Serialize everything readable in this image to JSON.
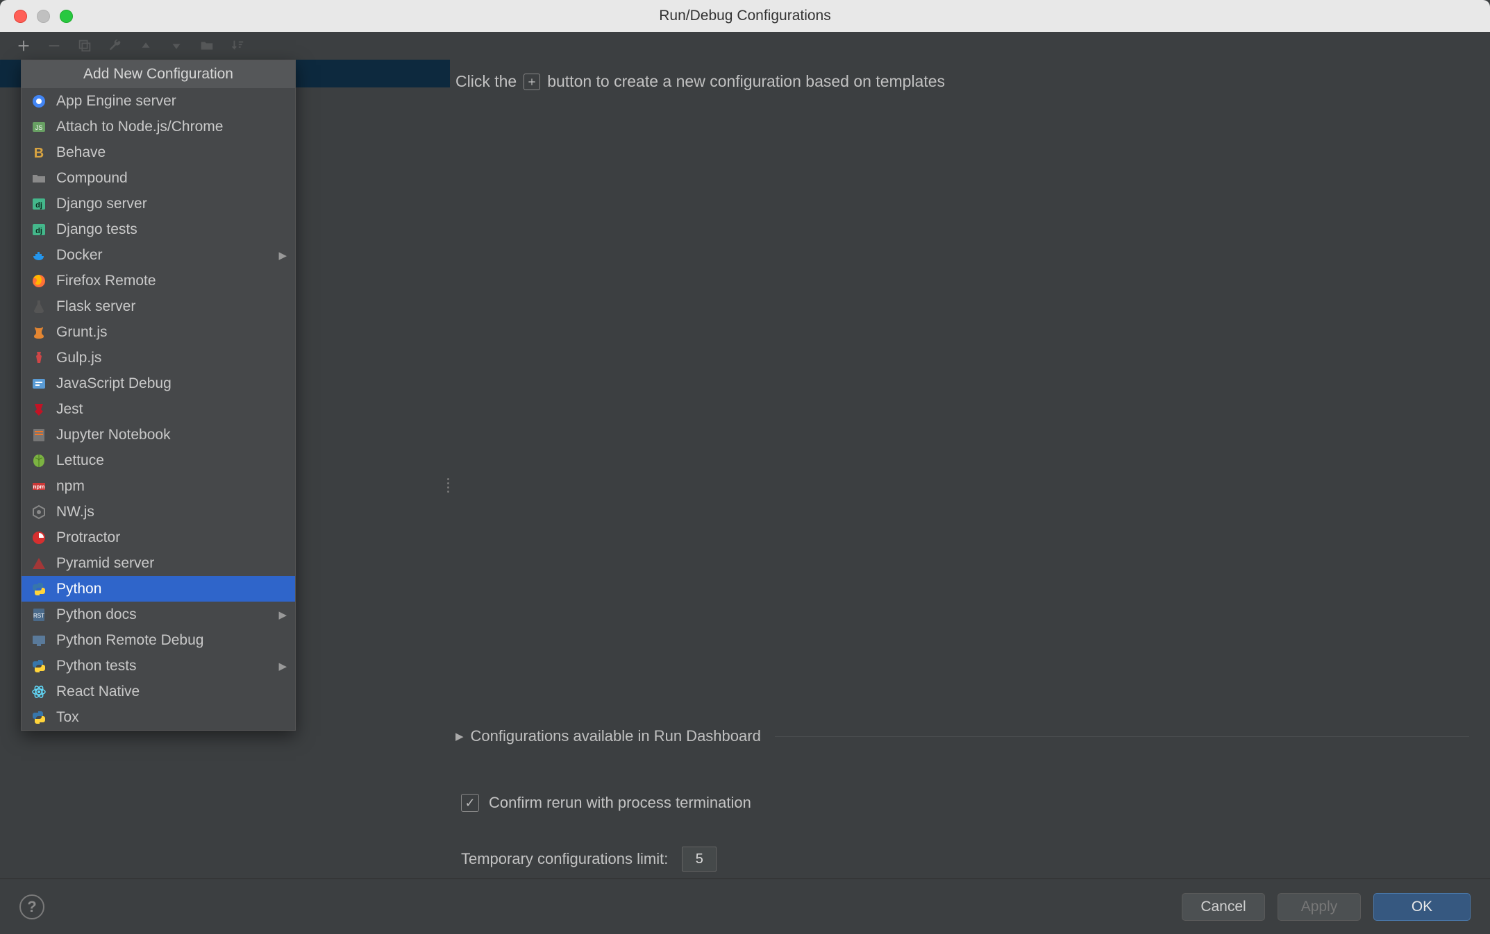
{
  "window": {
    "title": "Run/Debug Configurations"
  },
  "dropdown": {
    "header": "Add New Configuration",
    "items": [
      {
        "label": "App Engine server",
        "icon": "appengine",
        "submenu": false
      },
      {
        "label": "Attach to Node.js/Chrome",
        "icon": "nodejs",
        "submenu": false
      },
      {
        "label": "Behave",
        "icon": "behave",
        "submenu": false
      },
      {
        "label": "Compound",
        "icon": "folder",
        "submenu": false
      },
      {
        "label": "Django server",
        "icon": "django",
        "submenu": false
      },
      {
        "label": "Django tests",
        "icon": "django",
        "submenu": false
      },
      {
        "label": "Docker",
        "icon": "docker",
        "submenu": true
      },
      {
        "label": "Firefox Remote",
        "icon": "firefox",
        "submenu": false
      },
      {
        "label": "Flask server",
        "icon": "flask",
        "submenu": false
      },
      {
        "label": "Grunt.js",
        "icon": "grunt",
        "submenu": false
      },
      {
        "label": "Gulp.js",
        "icon": "gulp",
        "submenu": false
      },
      {
        "label": "JavaScript Debug",
        "icon": "jsdebug",
        "submenu": false
      },
      {
        "label": "Jest",
        "icon": "jest",
        "submenu": false
      },
      {
        "label": "Jupyter Notebook",
        "icon": "jupyter",
        "submenu": false
      },
      {
        "label": "Lettuce",
        "icon": "lettuce",
        "submenu": false
      },
      {
        "label": "npm",
        "icon": "npm",
        "submenu": false
      },
      {
        "label": "NW.js",
        "icon": "nwjs",
        "submenu": false
      },
      {
        "label": "Protractor",
        "icon": "protractor",
        "submenu": false
      },
      {
        "label": "Pyramid server",
        "icon": "pyramid",
        "submenu": false
      },
      {
        "label": "Python",
        "icon": "python",
        "submenu": false,
        "selected": true
      },
      {
        "label": "Python docs",
        "icon": "pythondocs",
        "submenu": true
      },
      {
        "label": "Python Remote Debug",
        "icon": "pyremote",
        "submenu": false
      },
      {
        "label": "Python tests",
        "icon": "python",
        "submenu": true
      },
      {
        "label": "React Native",
        "icon": "react",
        "submenu": false
      },
      {
        "label": "Tox",
        "icon": "python",
        "submenu": false
      }
    ]
  },
  "hint": {
    "pre": "Click the",
    "post": "button to create a new configuration based on templates"
  },
  "dashboard": {
    "label": "Configurations available in Run Dashboard"
  },
  "confirm": {
    "label": "Confirm rerun with process termination",
    "checked": true
  },
  "limit": {
    "label": "Temporary configurations limit:",
    "value": "5"
  },
  "buttons": {
    "cancel": "Cancel",
    "apply": "Apply",
    "ok": "OK"
  }
}
